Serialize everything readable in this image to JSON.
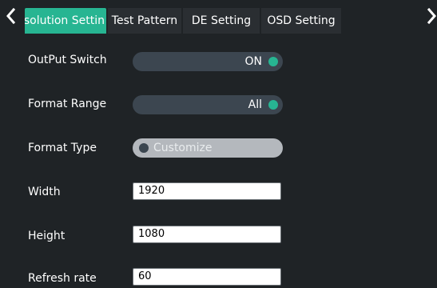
{
  "header": {
    "back_icon": "chevron-left-icon",
    "next_icon": "chevron-right-icon",
    "tabs": [
      {
        "label": "esolution Settin",
        "active": true
      },
      {
        "label": "Test Pattern",
        "active": false
      },
      {
        "label": "DE Setting",
        "active": false
      },
      {
        "label": "OSD Setting",
        "active": false
      }
    ]
  },
  "settings": {
    "output_switch": {
      "label": "OutPut Switch",
      "value": "ON"
    },
    "format_range": {
      "label": "Format Range",
      "value": "All"
    },
    "format_type": {
      "label": "Format Type",
      "value": "Customize"
    },
    "width": {
      "label": "Width",
      "value": "1920"
    },
    "height": {
      "label": "Height",
      "value": "1080"
    },
    "refresh_rate": {
      "label": "Refresh rate",
      "value": "60"
    }
  },
  "colors": {
    "accent": "#27b592",
    "background": "#1f2326",
    "toggle_on_bg": "#3c4650",
    "toggle_off_bg": "#b4b8bd"
  }
}
